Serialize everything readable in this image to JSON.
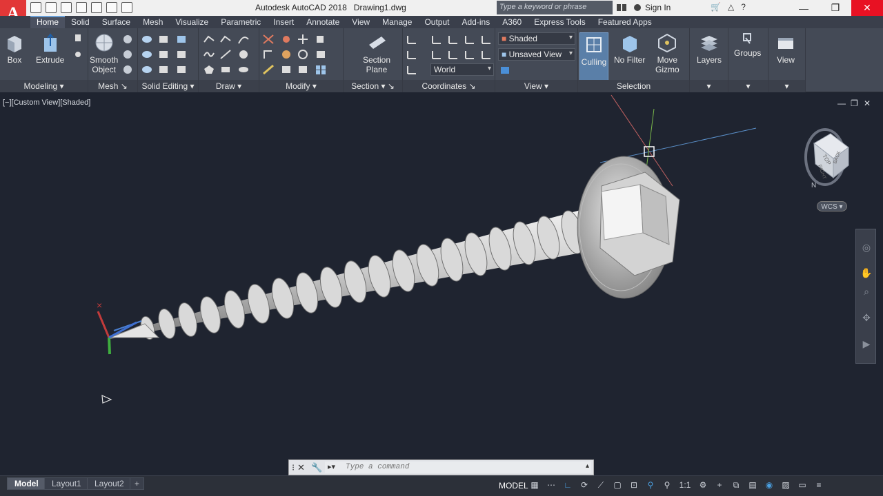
{
  "app": {
    "logo": "A",
    "title": "Autodesk AutoCAD 2018",
    "document": "Drawing1.dwg"
  },
  "search": {
    "placeholder": "Type a keyword or phrase"
  },
  "account": {
    "sign_in": "Sign In"
  },
  "tabs": [
    "Home",
    "Solid",
    "Surface",
    "Mesh",
    "Visualize",
    "Parametric",
    "Insert",
    "Annotate",
    "View",
    "Manage",
    "Output",
    "Add-ins",
    "A360",
    "Express Tools",
    "Featured Apps"
  ],
  "ribbon": {
    "modeling": {
      "label": "Modeling",
      "box": "Box",
      "extrude": "Extrude"
    },
    "mesh": {
      "label": "Mesh",
      "smooth_object_1": "Smooth",
      "smooth_object_2": "Object"
    },
    "solid_editing": {
      "label": "Solid Editing"
    },
    "draw": {
      "label": "Draw"
    },
    "modify": {
      "label": "Modify"
    },
    "section": {
      "label": "Section",
      "plane_1": "Section",
      "plane_2": "Plane"
    },
    "coordinates": {
      "label": "Coordinates",
      "world": "World"
    },
    "view": {
      "label": "View",
      "visual_style": "Shaded",
      "named_view": "Unsaved View"
    },
    "selection": {
      "label": "Selection",
      "culling": "Culling",
      "no_filter": "No Filter",
      "move_gizmo_1": "Move",
      "move_gizmo_2": "Gizmo"
    },
    "layers": {
      "label": "Layers"
    },
    "groups": {
      "label": "Groups"
    },
    "view_panel": {
      "label": "View"
    }
  },
  "viewport": {
    "label": "[−][Custom View][Shaded]",
    "wcs": "WCS",
    "cube_face_top": "TOP",
    "cube_face_right": "RIGHT",
    "cube_face_back": "BACK",
    "compass_n": "N"
  },
  "command": {
    "placeholder": "Type a command"
  },
  "layouts": [
    "Model",
    "Layout1",
    "Layout2"
  ],
  "layout_add": "+",
  "status": {
    "model": "MODEL",
    "scale": "1:1"
  },
  "colors": {
    "accent": "#6aa0d8",
    "close": "#e81123",
    "logo": "#e23737"
  }
}
